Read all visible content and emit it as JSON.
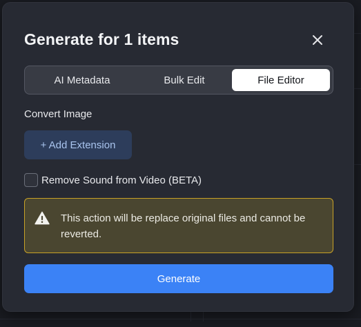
{
  "dialog": {
    "title": "Generate for 1 items",
    "close_icon": "close-icon"
  },
  "tabs": [
    {
      "label": "AI Metadata",
      "active": false
    },
    {
      "label": "Bulk Edit",
      "active": false
    },
    {
      "label": "File Editor",
      "active": true
    }
  ],
  "convert": {
    "label": "Convert Image",
    "add_button_label": "+ Add Extension"
  },
  "remove_sound": {
    "label": "Remove Sound from Video (BETA)",
    "checked": false
  },
  "warning": {
    "icon": "warning-icon",
    "text": "This action will be replace original files and cannot be reverted."
  },
  "generate_label": "Generate",
  "colors": {
    "primary": "#3b82f6",
    "warning_border": "#c9a227",
    "warning_bg": "#4a4630",
    "dialog_bg": "#272a33"
  }
}
